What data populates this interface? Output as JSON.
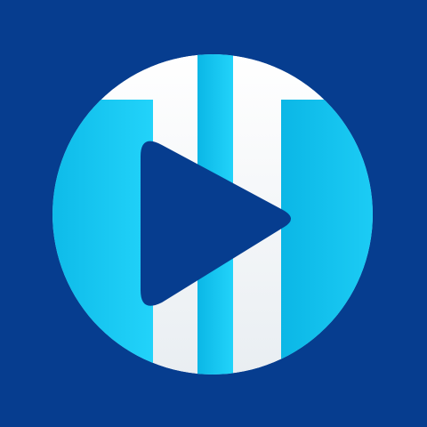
{
  "icon": {
    "name": "media-player-app-icon",
    "glyph": "play-icon",
    "colors": {
      "background": "#063D8F",
      "disc_white": "#FFFFFF",
      "stripe_cyan_light": "#22D3FA",
      "stripe_cyan_dark": "#0BB7E6",
      "play_triangle": "#063D8F"
    }
  }
}
